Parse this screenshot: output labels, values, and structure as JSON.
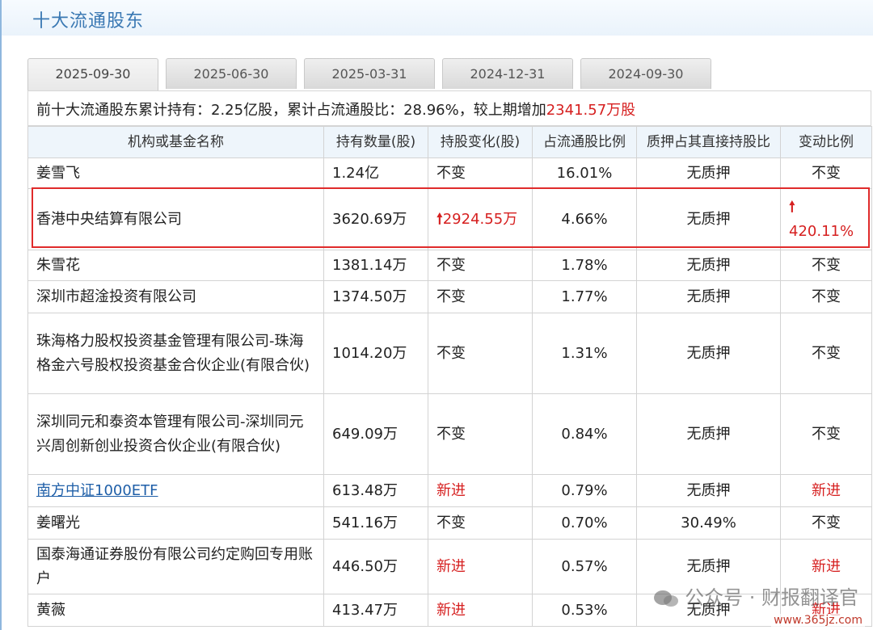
{
  "title": "十大流通股东",
  "tabs": [
    {
      "label": "2025-09-30",
      "active": true
    },
    {
      "label": "2025-06-30",
      "active": false
    },
    {
      "label": "2025-03-31",
      "active": false
    },
    {
      "label": "2024-12-31",
      "active": false
    },
    {
      "label": "2024-09-30",
      "active": false
    }
  ],
  "summary": {
    "prefix": "前十大流通股东累计持有：2.25亿股，累计占流通股比：28.96%，较上期增加",
    "increase": "2341.57万股"
  },
  "table": {
    "headers": [
      "机构或基金名称",
      "持有数量(股)",
      "持股变化(股)",
      "占流通股比例",
      "质押占其直接持股比",
      "变动比例"
    ],
    "rows": [
      {
        "name": "姜雪飞",
        "qty": "1.24亿",
        "change": "不变",
        "pct": "16.01%",
        "pledge": "无质押",
        "ratio": "不变"
      },
      {
        "name": "香港中央结算有限公司",
        "qty": "3620.69万",
        "change": "2924.55万",
        "pct": "4.66%",
        "pledge": "无质押",
        "ratio": "420.11%"
      },
      {
        "name": "朱雪花",
        "qty": "1381.14万",
        "change": "不变",
        "pct": "1.78%",
        "pledge": "无质押",
        "ratio": "不变"
      },
      {
        "name": "深圳市超淦投资有限公司",
        "qty": "1374.50万",
        "change": "不变",
        "pct": "1.77%",
        "pledge": "无质押",
        "ratio": "不变"
      },
      {
        "name": "珠海格力股权投资基金管理有限公司-珠海格金六号股权投资基金合伙企业(有限合伙)",
        "qty": "1014.20万",
        "change": "不变",
        "pct": "1.31%",
        "pledge": "无质押",
        "ratio": "不变"
      },
      {
        "name": "深圳同元和泰资本管理有限公司-深圳同元兴周创新创业投资合伙企业(有限合伙)",
        "qty": "649.09万",
        "change": "不变",
        "pct": "0.84%",
        "pledge": "无质押",
        "ratio": "不变"
      },
      {
        "name": "南方中证1000ETF",
        "qty": "613.48万",
        "change": "新进",
        "pct": "0.79%",
        "pledge": "无质押",
        "ratio": "新进"
      },
      {
        "name": "姜曙光",
        "qty": "541.16万",
        "change": "不变",
        "pct": "0.70%",
        "pledge": "30.49%",
        "ratio": "不变"
      },
      {
        "name": "国泰海通证券股份有限公司约定购回专用账户",
        "qty": "446.50万",
        "change": "新进",
        "pct": "0.57%",
        "pledge": "无质押",
        "ratio": "新进"
      },
      {
        "name": "黄薇",
        "qty": "413.47万",
        "change": "新进",
        "pct": "0.53%",
        "pledge": "无质押",
        "ratio": "新进"
      }
    ]
  },
  "watermark": "公众号 · 财报翻译官",
  "site": "www.365jz.com",
  "colors": {
    "accent_blue": "#3a78b3",
    "red": "#d62020",
    "header_bg": "#eef5fb",
    "highlight": "#e02b2b"
  }
}
